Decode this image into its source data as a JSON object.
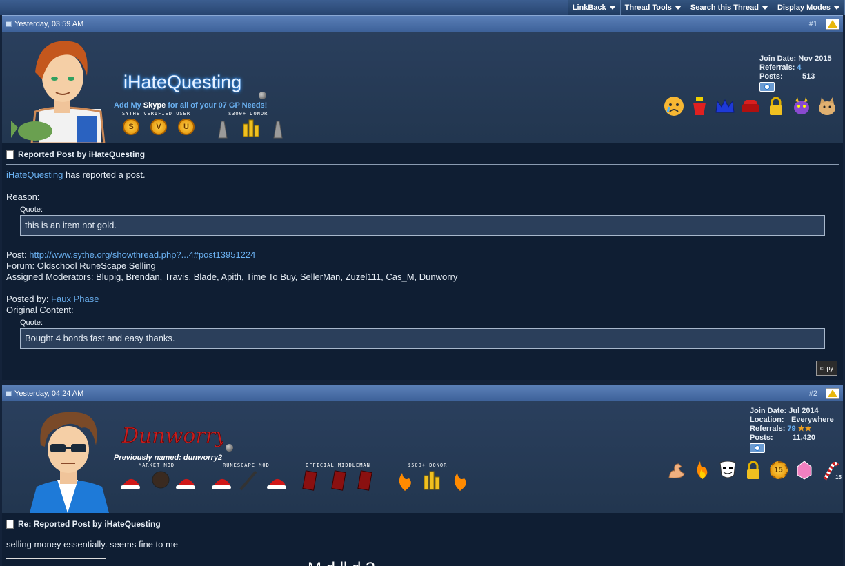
{
  "toolbar": {
    "items": [
      "LinkBack",
      "Thread Tools",
      "Search this Thread",
      "Display Modes"
    ]
  },
  "post1": {
    "date": "Yesterday, 03:59 AM",
    "number": "#1",
    "username": "iHateQuesting",
    "tagline_pre": "Add My ",
    "tagline_skype": "Skype",
    "tagline_post": " for all of your 07 GP Needs!",
    "badge_labels": [
      "SYTHE VERIFIED USER",
      "$300+ DONOR"
    ],
    "verified_letters": [
      "S",
      "V",
      "U"
    ],
    "join_date_label": "Join Date:",
    "join_date": "Nov 2015",
    "referrals_label": "Referrals:",
    "referrals": "4",
    "posts_label": "Posts:",
    "posts": "513",
    "title": "Reported Post by iHateQuesting",
    "reporter": "iHateQuesting",
    "reported_text": " has reported a post.",
    "reason_label": "Reason:",
    "quote_label": "Quote:",
    "reason_quote": "this is an item not gold.",
    "post_label": "Post: ",
    "post_link": "http://www.sythe.org/showthread.php?...4#post13951224",
    "forum_line": "Forum: Oldschool RuneScape Selling",
    "moderators_line": "Assigned Moderators: Blupig, Brendan, Travis, Blade, Apith, Time To Buy, SellerMan, Zuzel111, Cas_M, Dunworry",
    "posted_by_label": "Posted by: ",
    "posted_by": "Faux Phase",
    "original_label": "Original Content:",
    "original_quote": "Bought 4 bonds fast and easy thanks.",
    "copy_label": "copy",
    "icons": [
      "crying-face-icon",
      "bucket-icon",
      "blue-crown-icon",
      "red-armchair-icon",
      "padlock-icon",
      "purple-dragon-icon",
      "doge-icon"
    ]
  },
  "post2": {
    "date": "Yesterday, 04:24 AM",
    "number": "#2",
    "username": "Dunworry",
    "prev_name": "Previously named: dunworry2",
    "badge_labels": [
      "MARKET MOD",
      "RUNESCAPE MOD",
      "OFFICIAL MIDDLEMAN",
      "$500+ DONOR"
    ],
    "join_date_label": "Join Date:",
    "join_date": "Jul 2014",
    "location_label": "Location:",
    "location": "Everywhere",
    "referrals_label": "Referrals:",
    "referrals": "79",
    "posts_label": "Posts:",
    "posts": "11,420",
    "icon_count": "15",
    "icon_count_small": "15",
    "title": "Re: Reported Post by iHateQuesting",
    "body": "selling money essentially. seems fine to me",
    "cutoff_text": "M    d     ll   d     ?",
    "icons": [
      "flexed-arm-icon",
      "fire-icon",
      "guy-fawkes-mask-icon",
      "padlock-icon",
      "gold-15-coin-icon",
      "pink-gem-icon",
      "candy-cane-icon"
    ]
  },
  "colors": {
    "link": "#6ab0f0",
    "header_blue": "#4a6fa8",
    "body_bg": "#0f1e33",
    "accent_red": "#c81e1e"
  }
}
